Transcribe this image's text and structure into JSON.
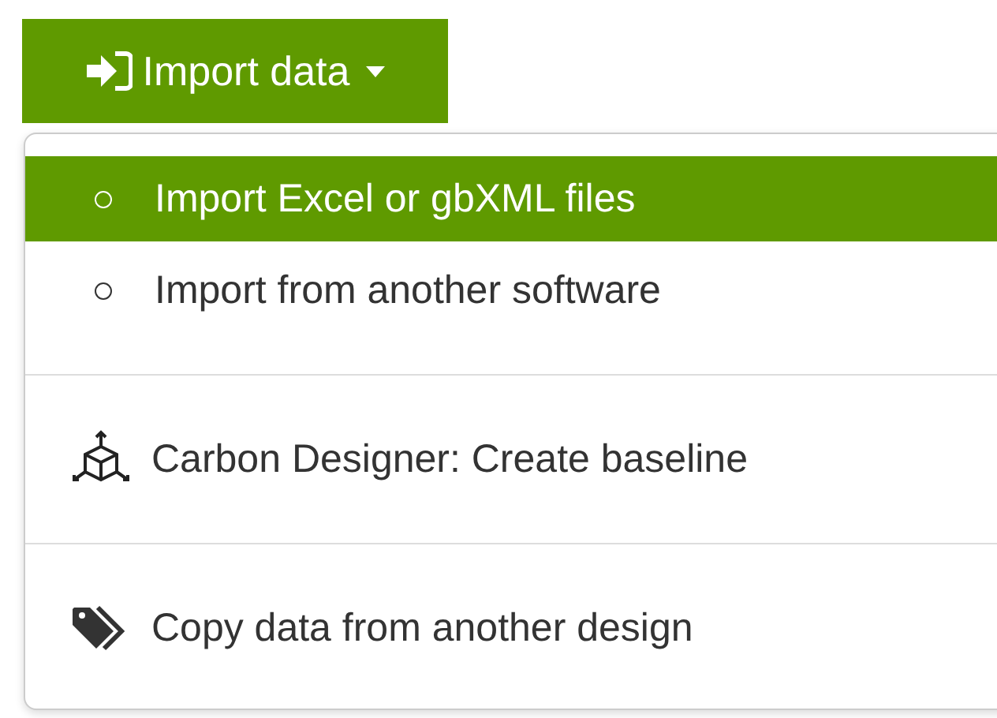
{
  "button": {
    "label": "Import data"
  },
  "menu": {
    "groups": [
      {
        "items": [
          {
            "kind": "bullet",
            "label": "Import Excel or gbXML files",
            "selected": true
          },
          {
            "kind": "bullet",
            "label": "Import from another software",
            "selected": false
          }
        ]
      },
      {
        "items": [
          {
            "kind": "cube",
            "label": "Carbon Designer: Create baseline",
            "selected": false
          }
        ]
      },
      {
        "items": [
          {
            "kind": "tags",
            "label": "Copy data from another design",
            "selected": false
          }
        ]
      }
    ]
  }
}
